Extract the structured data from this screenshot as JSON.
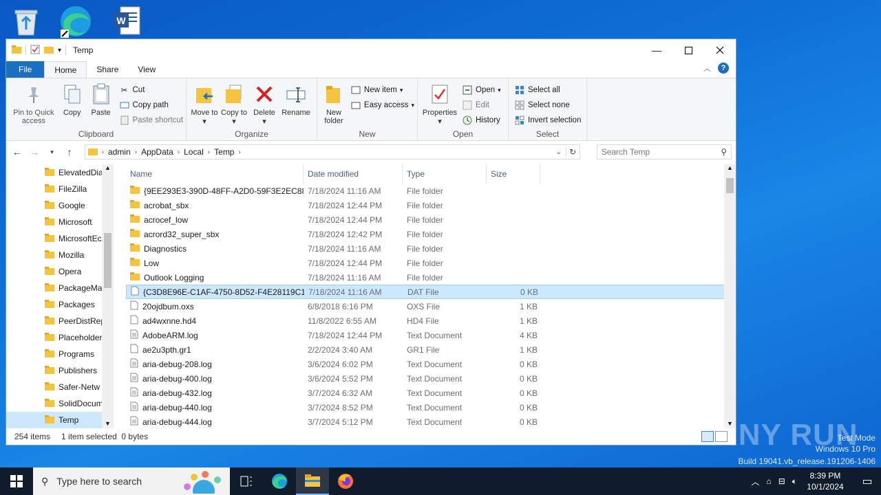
{
  "window": {
    "title": "Temp"
  },
  "ribbon": {
    "tabs": [
      "File",
      "Home",
      "Share",
      "View"
    ],
    "clipboard": {
      "label": "Clipboard",
      "pin": "Pin to Quick access",
      "copy": "Copy",
      "paste": "Paste",
      "cut": "Cut",
      "copy_path": "Copy path",
      "paste_shortcut": "Paste shortcut"
    },
    "organize": {
      "label": "Organize",
      "move_to": "Move to",
      "copy_to": "Copy to",
      "delete": "Delete",
      "rename": "Rename"
    },
    "new": {
      "label": "New",
      "new_folder": "New folder",
      "new_item": "New item",
      "easy_access": "Easy access"
    },
    "open": {
      "label": "Open",
      "properties": "Properties",
      "open": "Open",
      "edit": "Edit",
      "history": "History"
    },
    "select": {
      "label": "Select",
      "select_all": "Select all",
      "select_none": "Select none",
      "invert": "Invert selection"
    }
  },
  "address": {
    "crumbs": [
      "admin",
      "AppData",
      "Local",
      "Temp"
    ],
    "search_placeholder": "Search Temp"
  },
  "nav_items": [
    "ElevatedDia",
    "FileZilla",
    "Google",
    "Microsoft",
    "MicrosoftEc",
    "Mozilla",
    "Opera",
    "PackageMa",
    "Packages",
    "PeerDistRep",
    "Placeholder",
    "Programs",
    "Publishers",
    "Safer-Netw",
    "SolidDocum",
    "Temp"
  ],
  "columns": {
    "name": "Name",
    "date": "Date modified",
    "type": "Type",
    "size": "Size"
  },
  "files": [
    {
      "name": "{9EE293E3-390D-48FF-A2D0-59F3E2EC88...",
      "date": "7/18/2024 11:16 AM",
      "type": "File folder",
      "size": "",
      "kind": "folder"
    },
    {
      "name": "acrobat_sbx",
      "date": "7/18/2024 12:44 PM",
      "type": "File folder",
      "size": "",
      "kind": "folder"
    },
    {
      "name": "acrocef_low",
      "date": "7/18/2024 12:44 PM",
      "type": "File folder",
      "size": "",
      "kind": "folder"
    },
    {
      "name": "acrord32_super_sbx",
      "date": "7/18/2024 12:42 PM",
      "type": "File folder",
      "size": "",
      "kind": "folder"
    },
    {
      "name": "Diagnostics",
      "date": "7/18/2024 11:16 AM",
      "type": "File folder",
      "size": "",
      "kind": "folder"
    },
    {
      "name": "Low",
      "date": "7/18/2024 12:44 PM",
      "type": "File folder",
      "size": "",
      "kind": "folder"
    },
    {
      "name": "Outlook Logging",
      "date": "7/18/2024 11:16 AM",
      "type": "File folder",
      "size": "",
      "kind": "folder"
    },
    {
      "name": "{C3D8E96E-C1AF-4750-8D52-F4E28119C1...",
      "date": "7/18/2024 11:16 AM",
      "type": "DAT File",
      "size": "0 KB",
      "kind": "file",
      "selected": true
    },
    {
      "name": "20ojdbum.oxs",
      "date": "6/8/2018 6:16 PM",
      "type": "OXS File",
      "size": "1 KB",
      "kind": "file"
    },
    {
      "name": "ad4wxnne.hd4",
      "date": "11/8/2022 6:55 AM",
      "type": "HD4 File",
      "size": "1 KB",
      "kind": "file"
    },
    {
      "name": "AdobeARM.log",
      "date": "7/18/2024 12:44 PM",
      "type": "Text Document",
      "size": "4 KB",
      "kind": "text"
    },
    {
      "name": "ae2u3pth.gr1",
      "date": "2/2/2024 3:40 AM",
      "type": "GR1 File",
      "size": "1 KB",
      "kind": "file"
    },
    {
      "name": "aria-debug-208.log",
      "date": "3/6/2024 6:02 PM",
      "type": "Text Document",
      "size": "0 KB",
      "kind": "text"
    },
    {
      "name": "aria-debug-400.log",
      "date": "3/6/2024 5:52 PM",
      "type": "Text Document",
      "size": "0 KB",
      "kind": "text"
    },
    {
      "name": "aria-debug-432.log",
      "date": "3/7/2024 6:32 AM",
      "type": "Text Document",
      "size": "0 KB",
      "kind": "text"
    },
    {
      "name": "aria-debug-440.log",
      "date": "3/7/2024 8:52 PM",
      "type": "Text Document",
      "size": "0 KB",
      "kind": "text"
    },
    {
      "name": "aria-debug-444.log",
      "date": "3/7/2024 5:12 PM",
      "type": "Text Document",
      "size": "0 KB",
      "kind": "text"
    }
  ],
  "status": {
    "count": "254 items",
    "selection": "1 item selected  0 bytes"
  },
  "taskbar": {
    "search_placeholder": "Type here to search",
    "time": "8:39 PM",
    "date": "10/1/2024"
  },
  "watermark": {
    "line1": "Test Mode",
    "line2": "Windows 10 Pro",
    "line3": "Build 19041.vb_release.191206-1406",
    "brand": "ANY RUN"
  },
  "colors": {
    "accent": "#1a6fc0",
    "selection": "#cce8ff",
    "folder": "#f5c342"
  }
}
